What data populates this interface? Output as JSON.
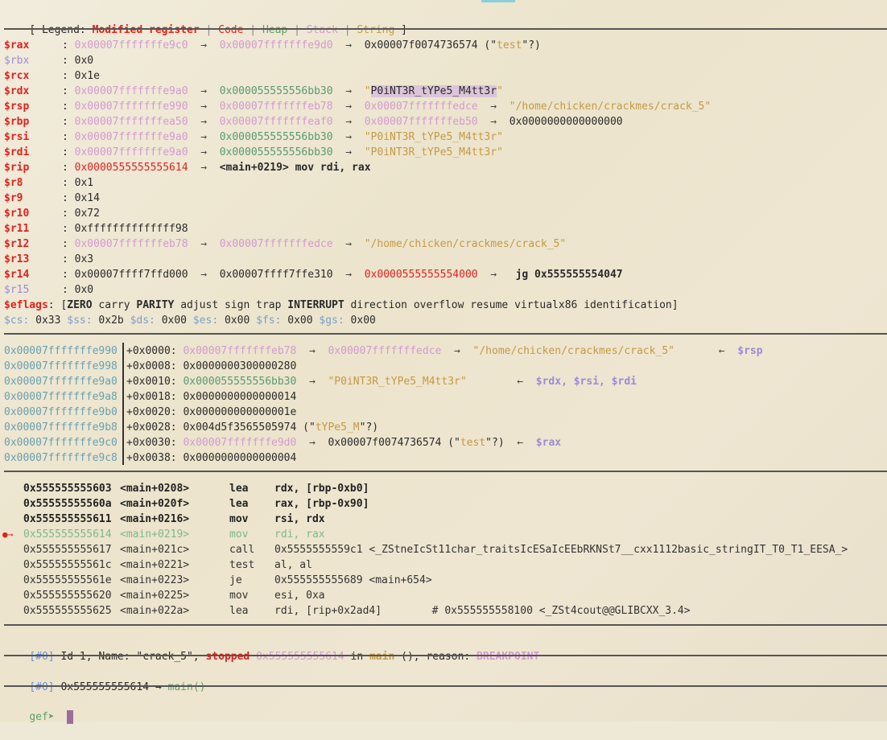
{
  "legend": {
    "prefix": "[ Legend: ",
    "modified": "Modified register",
    "sep": " | ",
    "code": "Code",
    "heap": "Heap",
    "stack": "Stack",
    "string": "String",
    "suffix": " ]"
  },
  "registers": [
    {
      "name": "$rax",
      "mod": true,
      "parts": [
        {
          "t": "0x00007fffffffe9c0",
          "c": "pink"
        },
        {
          "t": "  →  ",
          "c": "arrow"
        },
        {
          "t": "0x00007fffffffe9d0",
          "c": "pink"
        },
        {
          "t": "  →  ",
          "c": "arrow"
        },
        {
          "t": "0x00007f0074736574 (\"",
          "c": ""
        },
        {
          "t": "test",
          "c": "yellow"
        },
        {
          "t": "\"?)",
          "c": ""
        }
      ]
    },
    {
      "name": "$rbx",
      "mod": false,
      "parts": [
        {
          "t": "0x0",
          "c": ""
        }
      ]
    },
    {
      "name": "$rcx",
      "mod": true,
      "parts": [
        {
          "t": "0x1e",
          "c": ""
        }
      ]
    },
    {
      "name": "$rdx",
      "mod": true,
      "parts": [
        {
          "t": "0x00007fffffffe9a0",
          "c": "pink"
        },
        {
          "t": "  →  ",
          "c": "arrow"
        },
        {
          "t": "0x000055555556bb30",
          "c": "green"
        },
        {
          "t": "  →  ",
          "c": "arrow"
        },
        {
          "t": "\"",
          "c": "yellow"
        },
        {
          "t": "P0iNT3R_tYPe5_M4tt3r",
          "c": "hl"
        },
        {
          "t": "\"",
          "c": "yellow"
        }
      ]
    },
    {
      "name": "$rsp",
      "mod": true,
      "parts": [
        {
          "t": "0x00007fffffffe990",
          "c": "pink"
        },
        {
          "t": "  →  ",
          "c": "arrow"
        },
        {
          "t": "0x00007fffffffeb78",
          "c": "pink"
        },
        {
          "t": "  →  ",
          "c": "arrow"
        },
        {
          "t": "0x00007fffffffedce",
          "c": "pink"
        },
        {
          "t": "  →  ",
          "c": "arrow"
        },
        {
          "t": "\"/home/chicken/crackmes/crack_5\"",
          "c": "yellow"
        }
      ]
    },
    {
      "name": "$rbp",
      "mod": true,
      "parts": [
        {
          "t": "0x00007fffffffea50",
          "c": "pink"
        },
        {
          "t": "  →  ",
          "c": "arrow"
        },
        {
          "t": "0x00007fffffffeaf0",
          "c": "pink"
        },
        {
          "t": "  →  ",
          "c": "arrow"
        },
        {
          "t": "0x00007fffffffeb50",
          "c": "pink"
        },
        {
          "t": "  →  ",
          "c": "arrow"
        },
        {
          "t": "0x0000000000000000",
          "c": ""
        }
      ]
    },
    {
      "name": "$rsi",
      "mod": true,
      "parts": [
        {
          "t": "0x00007fffffffe9a0",
          "c": "pink"
        },
        {
          "t": "  →  ",
          "c": "arrow"
        },
        {
          "t": "0x000055555556bb30",
          "c": "green"
        },
        {
          "t": "  →  ",
          "c": "arrow"
        },
        {
          "t": "\"P0iNT3R_tYPe5_M4tt3r\"",
          "c": "yellow"
        }
      ]
    },
    {
      "name": "$rdi",
      "mod": true,
      "parts": [
        {
          "t": "0x00007fffffffe9a0",
          "c": "pink"
        },
        {
          "t": "  →  ",
          "c": "arrow"
        },
        {
          "t": "0x000055555556bb30",
          "c": "green"
        },
        {
          "t": "  →  ",
          "c": "arrow"
        },
        {
          "t": "\"P0iNT3R_tYPe5_M4tt3r\"",
          "c": "yellow"
        }
      ]
    },
    {
      "name": "$rip",
      "mod": true,
      "parts": [
        {
          "t": "0x0000555555555614",
          "c": "redn"
        },
        {
          "t": "  →  ",
          "c": "arrow"
        },
        {
          "t": "<main+0219> mov rdi, rax",
          "c": "bold"
        }
      ]
    },
    {
      "name": "$r8",
      "mod": true,
      "parts": [
        {
          "t": "0x1",
          "c": ""
        }
      ]
    },
    {
      "name": "$r9",
      "mod": true,
      "parts": [
        {
          "t": "0x14",
          "c": ""
        }
      ]
    },
    {
      "name": "$r10",
      "mod": true,
      "parts": [
        {
          "t": "0x72",
          "c": ""
        }
      ]
    },
    {
      "name": "$r11",
      "mod": true,
      "parts": [
        {
          "t": "0xffffffffffffff98",
          "c": ""
        }
      ]
    },
    {
      "name": "$r12",
      "mod": true,
      "parts": [
        {
          "t": "0x00007fffffffeb78",
          "c": "pink"
        },
        {
          "t": "  →  ",
          "c": "arrow"
        },
        {
          "t": "0x00007fffffffedce",
          "c": "pink"
        },
        {
          "t": "  →  ",
          "c": "arrow"
        },
        {
          "t": "\"/home/chicken/crackmes/crack_5\"",
          "c": "yellow"
        }
      ]
    },
    {
      "name": "$r13",
      "mod": true,
      "parts": [
        {
          "t": "0x3",
          "c": ""
        }
      ]
    },
    {
      "name": "$r14",
      "mod": true,
      "parts": [
        {
          "t": "0x00007ffff7ffd000",
          "c": ""
        },
        {
          "t": "  →  ",
          "c": "arrow"
        },
        {
          "t": "0x00007ffff7ffe310",
          "c": ""
        },
        {
          "t": "  →  ",
          "c": "arrow"
        },
        {
          "t": "0x0000555555554000",
          "c": "redn"
        },
        {
          "t": "  →   ",
          "c": "arrow"
        },
        {
          "t": "jg 0x555555554047",
          "c": "bold"
        }
      ]
    },
    {
      "name": "$r15",
      "mod": false,
      "parts": [
        {
          "t": "0x0",
          "c": ""
        }
      ]
    }
  ],
  "eflags": {
    "label": "$eflags",
    "text": ": [ZERO carry PARITY adjust sign trap INTERRUPT direction overflow resume virtualx86 identification]"
  },
  "segs": "$cs: 0x33 $ss: 0x2b $ds: 0x00 $es: 0x00 $fs: 0x00 $gs: 0x00",
  "stack": [
    {
      "addr": "0x00007fffffffe990",
      "off": "+0x0000: ",
      "parts": [
        {
          "t": "0x00007fffffffeb78",
          "c": "pink"
        },
        {
          "t": "  →  ",
          "c": "arrow"
        },
        {
          "t": "0x00007fffffffedce",
          "c": "pink"
        },
        {
          "t": "  →  ",
          "c": "arrow"
        },
        {
          "t": "\"/home/chicken/crackmes/crack_5\"",
          "c": "yellow"
        },
        {
          "t": "       ←  ",
          "c": "arrow"
        },
        {
          "t": "$rsp",
          "c": "purple"
        }
      ]
    },
    {
      "addr": "0x00007fffffffe998",
      "off": "+0x0008: ",
      "parts": [
        {
          "t": "0x0000000300000280",
          "c": ""
        }
      ]
    },
    {
      "addr": "0x00007fffffffe9a0",
      "off": "+0x0010: ",
      "parts": [
        {
          "t": "0x000055555556bb30",
          "c": "green"
        },
        {
          "t": "  →  ",
          "c": "arrow"
        },
        {
          "t": "\"P0iNT3R_tYPe5_M4tt3r\"",
          "c": "yellow"
        },
        {
          "t": "        ←  ",
          "c": "arrow"
        },
        {
          "t": "$rdx, $rsi, $rdi",
          "c": "purple"
        }
      ]
    },
    {
      "addr": "0x00007fffffffe9a8",
      "off": "+0x0018: ",
      "parts": [
        {
          "t": "0x0000000000000014",
          "c": ""
        }
      ]
    },
    {
      "addr": "0x00007fffffffe9b0",
      "off": "+0x0020: ",
      "parts": [
        {
          "t": "0x000000000000001e",
          "c": ""
        }
      ]
    },
    {
      "addr": "0x00007fffffffe9b8",
      "off": "+0x0028: ",
      "parts": [
        {
          "t": "0x004d5f3565505974 (\"",
          "c": ""
        },
        {
          "t": "tYPe5_M",
          "c": "yellow"
        },
        {
          "t": "\"?)",
          "c": ""
        }
      ]
    },
    {
      "addr": "0x00007fffffffe9c0",
      "off": "+0x0030: ",
      "parts": [
        {
          "t": "0x00007fffffffe9d0",
          "c": "pink"
        },
        {
          "t": "  →  ",
          "c": "arrow"
        },
        {
          "t": "0x00007f0074736574 (\"",
          "c": ""
        },
        {
          "t": "test",
          "c": "yellow"
        },
        {
          "t": "\"?)",
          "c": ""
        },
        {
          "t": "  ←  ",
          "c": "arrow"
        },
        {
          "t": "$rax",
          "c": "purple"
        }
      ]
    },
    {
      "addr": "0x00007fffffffe9c8",
      "off": "+0x0038: ",
      "parts": [
        {
          "t": "0x0000000000000004",
          "c": ""
        }
      ]
    }
  ],
  "code": [
    {
      "mark": "",
      "addr": "0x555555555603",
      "sym": "<main+0208>",
      "op": "lea",
      "args": "rdx, [rbp-0xb0]",
      "style": "bold"
    },
    {
      "mark": "",
      "addr": "0x55555555560a",
      "sym": "<main+020f>",
      "op": "lea",
      "args": "rax, [rbp-0x90]",
      "style": "bold"
    },
    {
      "mark": "",
      "addr": "0x555555555611",
      "sym": "<main+0216>",
      "op": "mov",
      "args": "rsi, rdx",
      "style": "bold"
    },
    {
      "mark": "●→",
      "addr": "0x555555555614",
      "sym": "<main+0219>",
      "op": "mov",
      "args": "rdi, rax",
      "style": "cur"
    },
    {
      "mark": "",
      "addr": "0x555555555617",
      "sym": "<main+021c>",
      "op": "call",
      "args": "0x5555555559c1 <_ZStneIcSt11char_traitsIcESaIcEEbRKNSt7__cxx1112basic_stringIT_T0_T1_EESA_>",
      "style": ""
    },
    {
      "mark": "",
      "addr": "0x55555555561c",
      "sym": "<main+0221>",
      "op": "test",
      "args": "al, al",
      "style": ""
    },
    {
      "mark": "",
      "addr": "0x55555555561e",
      "sym": "<main+0223>",
      "op": "je",
      "args": "0x555555555689 <main+654>",
      "style": ""
    },
    {
      "mark": "",
      "addr": "0x555555555620",
      "sym": "<main+0225>",
      "op": "mov",
      "args": "esi, 0xa",
      "style": ""
    },
    {
      "mark": "",
      "addr": "0x555555555625",
      "sym": "<main+022a>",
      "op": "lea",
      "args": "rdi, [rip+0x2ad4]        # 0x555555558100 <_ZSt4cout@@GLIBCXX_3.4>",
      "style": ""
    }
  ],
  "thread": {
    "id": "[#0]",
    "text1": " Id 1, Name: \"crack_5\", ",
    "stopped": "stopped",
    "addr": " 0x555555555614",
    "in": " in ",
    "fn": "main",
    "text2": " (), reason: ",
    "reason": "BREAKPOINT"
  },
  "trace": {
    "id": "[#0]",
    "text": " 0x555555555614 → ",
    "fn": "main()"
  },
  "prompt": "gef➤ "
}
